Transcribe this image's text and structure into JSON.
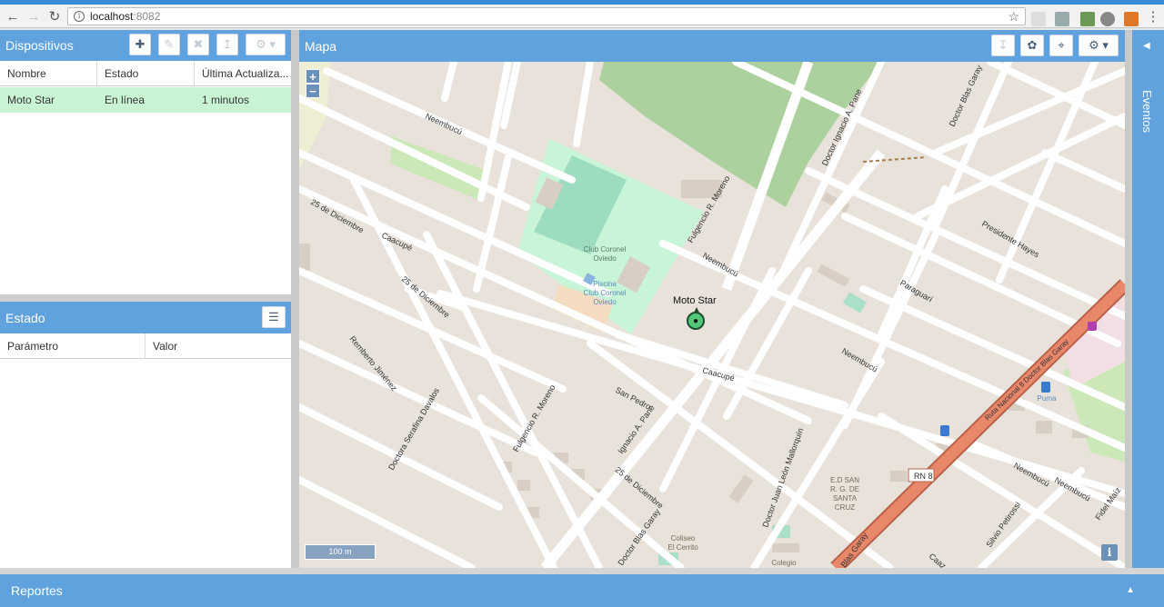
{
  "browser": {
    "url_host": "localhost",
    "url_port": ":8082",
    "back_icon": "arrow-left-icon",
    "forward_icon": "arrow-right-icon",
    "reload_icon": "reload-icon",
    "bookmark_icon": "star-icon"
  },
  "devices_panel": {
    "title": "Dispositivos",
    "columns": [
      "Nombre",
      "Estado",
      "Última Actualiza..."
    ],
    "rows": [
      {
        "name": "Moto Star",
        "status": "En línea",
        "updated": "1 minutos"
      }
    ]
  },
  "status_panel": {
    "title": "Estado",
    "columns": [
      "Parámetro",
      "Valor"
    ]
  },
  "map_panel": {
    "title": "Mapa",
    "zoom_in": "+",
    "zoom_out": "−",
    "scale_text": "100 m",
    "attribution": "i",
    "marker_label": "Moto Star",
    "street_labels": {
      "s1": "Neembucú",
      "s2": "25 de Diciembre",
      "s3": "Caacupé",
      "s4": "25 de Diciembre",
      "s5": "Remberto Jiménez",
      "s6": "Doctora Serafina Davalos",
      "s7": "Fulgencio R. Moreno",
      "s8": "Fulgencio R. Moreno",
      "s9": "Neembucú",
      "s10": "San Pedro",
      "s11": "Caacupé",
      "s12": "Ignacio A. Pane",
      "s13": "25 de Diciembre",
      "s14": "Doctor Blas Garay",
      "s15": "Doctor Juan León Mallorquín",
      "s16": "Neembucú",
      "s17": "Paraguarí",
      "s18": "Presidente Hayes",
      "s19": "Doctor Ignacio A. Pane",
      "s20": "Doctor Blas Garay",
      "s21": "Ruta Nacional 8 Doctor Blas Garay",
      "s22": "RN 8",
      "s23": "Neembucú",
      "s24": "Neembucú",
      "s25": "Silvio Petirossi",
      "s26": "Fidel Maíz",
      "s27": "Blas Garay",
      "s28": "Caaz"
    },
    "poi_labels": {
      "p1": "Club Coronel",
      "p2": "Oviedo",
      "p3": "Piscina",
      "p4": "Club Coronel",
      "p5": "Oviedo",
      "p6": "Puma",
      "p7": "E.D SAN",
      "p8": "R. G. DE",
      "p9": "SANTA",
      "p10": "CRUZ",
      "p11": "Coliseo",
      "p12": "El Cerrito",
      "p13": "Colegio"
    }
  },
  "events_panel": {
    "title": "Eventos"
  },
  "reports_panel": {
    "title": "Reportes"
  },
  "colors": {
    "accent": "#5fa2dd",
    "selected_row": "#c8f4d4",
    "map_bg": "#e8e2da",
    "road_main": "#e8876a",
    "park": "#add19e",
    "sport": "#c8f5d8"
  }
}
